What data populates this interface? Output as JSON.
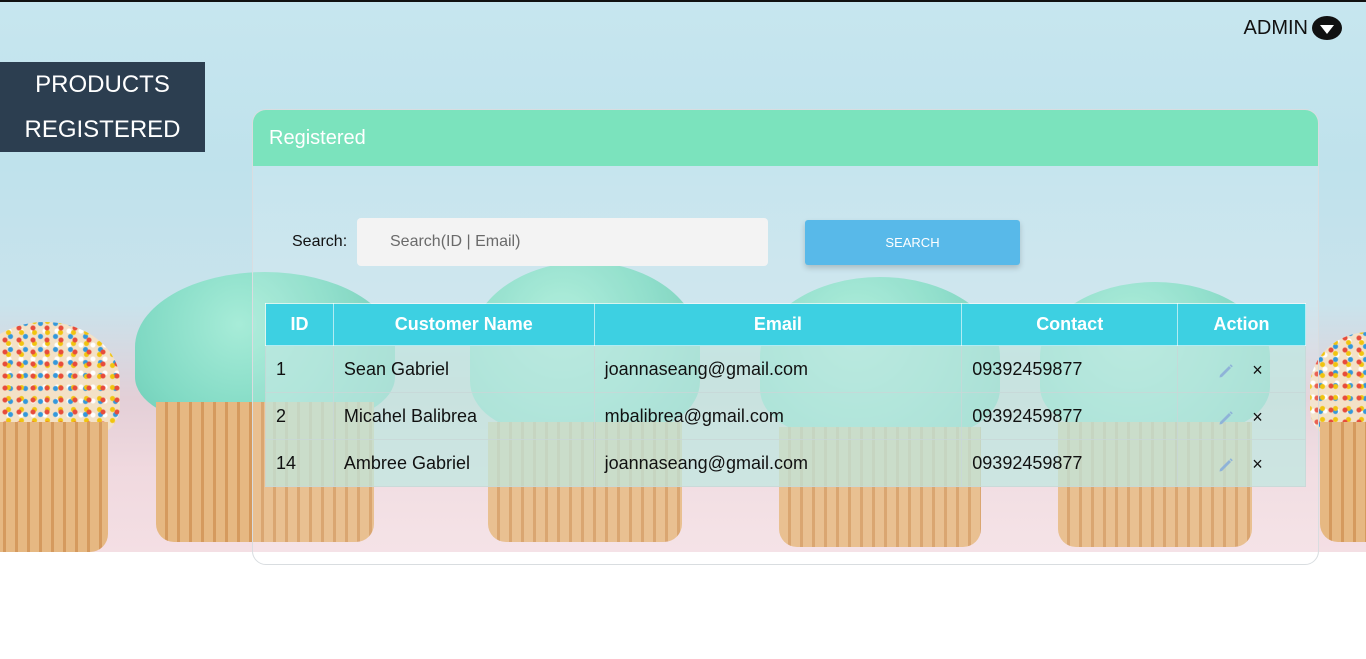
{
  "header": {
    "user_label": "ADMIN",
    "user_menu_icon": "caret-down-circle-icon"
  },
  "nav": {
    "items": [
      {
        "label": "PRODUCTS"
      },
      {
        "label": "REGISTERED"
      }
    ]
  },
  "panel": {
    "title": "Registered",
    "search": {
      "label": "Search:",
      "placeholder": "Search(ID | Email)",
      "value": "",
      "button_label": "SEARCH"
    },
    "table": {
      "columns": [
        "ID",
        "Customer Name",
        "Email",
        "Contact",
        "Action"
      ],
      "rows": [
        {
          "id": "1",
          "name": "Sean Gabriel",
          "email": "joannaseang@gmail.com",
          "contact": "09392459877"
        },
        {
          "id": "2",
          "name": "Micahel Balibrea",
          "email": "mbalibrea@gmail.com",
          "contact": "09392459877"
        },
        {
          "id": "14",
          "name": "Ambree Gabriel",
          "email": "joannaseang@gmail.com",
          "contact": "09392459877"
        }
      ],
      "action_icons": [
        "pencil-icon",
        "close-icon"
      ],
      "delete_glyph": "×"
    }
  },
  "colors": {
    "nav_bg": "#2c3e50",
    "panel_header": "#7be3bd",
    "table_header": "#3dd0e2",
    "search_button": "#58b9e9"
  }
}
